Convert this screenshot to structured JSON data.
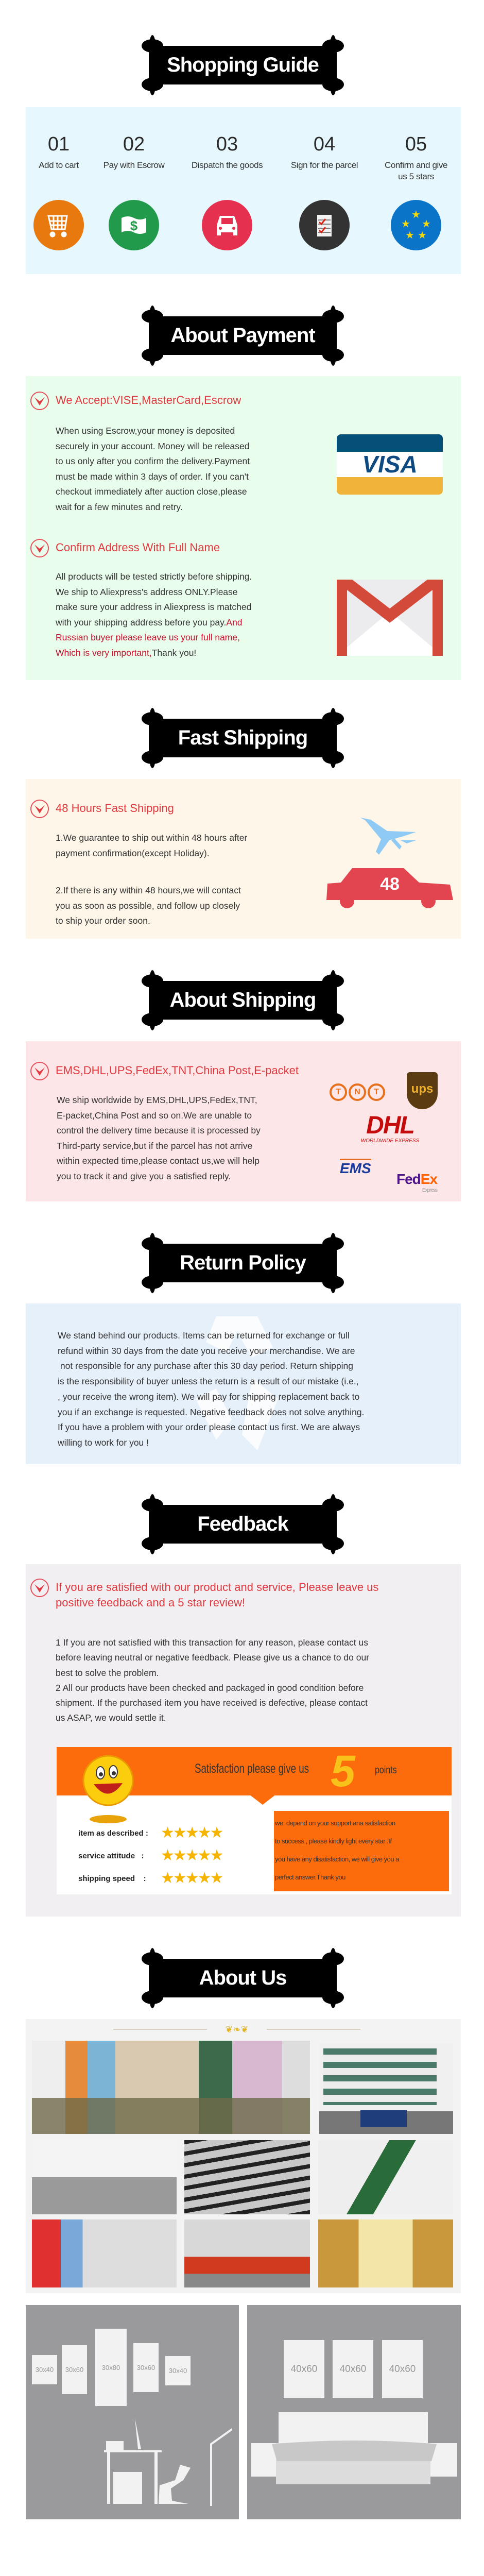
{
  "shopping_guide": {
    "title": "Shopping Guide",
    "steps": [
      {
        "num": "01",
        "label": "Add to cart",
        "icon": "cart-icon",
        "color": "#e8790f"
      },
      {
        "num": "02",
        "label": "Pay with Escrow",
        "icon": "money-icon",
        "color": "#229a4b"
      },
      {
        "num": "03",
        "label": "Dispatch the goods",
        "icon": "car-icon",
        "color": "#e5304f"
      },
      {
        "num": "04",
        "label": "Sign for the parcel",
        "icon": "checklist-icon",
        "color": "#333333"
      },
      {
        "num": "05",
        "label": "Confirm and give us 5 stars",
        "icon": "stars-icon",
        "color": "#0a74c9"
      }
    ]
  },
  "about_payment": {
    "title": "About Payment",
    "heading1": "We Accept:VISE,MasterCard,Escrow",
    "para1": [
      "When using Escrow,your money is deposited",
      "securely in your account. Money will be released",
      "to us only after you confirm the delivery.Payment",
      "must be made within 3 days of order. If you can't",
      "checkout immediately after auction close,please",
      "wait for a few minutes and retry."
    ],
    "visa_logo": "VISA",
    "heading2": "Confirm Address With Full Name",
    "para2": [
      "All products will be tested strictly before shipping.",
      "We ship to Aliexpress's address ONLY.Please",
      "make sure your address in Aliexpress is matched"
    ],
    "para2_line4": "with your shipping address before you pay.",
    "para2_line4_red": "And",
    "para2_red": [
      "Russian buyer please leave us your full name,"
    ],
    "para2_last_red": "Which is very important,",
    "para2_last": "Thank you!"
  },
  "fast_shipping": {
    "title": "Fast Shipping",
    "heading": "48 Hours Fast Shipping",
    "para1": [
      "1.We guarantee to ship out within 48 hours after",
      "payment confirmation(except Holiday)."
    ],
    "para2": [
      "2.If there is any within 48 hours,we will contact",
      "you as soon as possible, and follow up closely",
      "to ship your order soon."
    ],
    "car_badge": "48"
  },
  "about_shipping": {
    "title": "About Shipping",
    "heading": "EMS,DHL,UPS,FedEx,TNT,China Post,E-packet",
    "para": [
      "We ship worldwide by EMS,DHL,UPS,FedEx,TNT,",
      "E-packet,China Post and so on.We are unable to",
      "control the delivery time because it is processed by",
      "Third-party service,but if the parcel has not arrive",
      "within expected time,please contact us,we will help",
      "you to track it and give you a satisfied reply."
    ],
    "logos": {
      "tnt": "TNT",
      "ups": "ups",
      "dhl": "DHL",
      "dhl_sub": "WORLDWIDE EXPRESS",
      "ems": "EMS",
      "fedex_fed": "Fed",
      "fedex_ex": "Ex",
      "fedex_sub": "Express"
    }
  },
  "return_policy": {
    "title": "Return Policy",
    "para": [
      "We stand behind our products. Items can be returned for exchange or full",
      "refund within 30 days from the date you receive your merchandise. We are",
      " not responsible for any purchase after this 30 day period. Return shipping",
      "is the responsibility of buyer unless the return is a result of our mistake (i.e.,",
      ", your receive the wrong item). We will pay for shipping replacement back to",
      "you if an exchange is requested. Negative feedback does not solve anything.",
      "If you have a problem with your order please contact us first. We are always",
      "willing to work for you !"
    ]
  },
  "feedback": {
    "title": "Feedback",
    "heading": [
      "If you are satisfied with our product and service, Please leave us",
      "positive feedback and a 5 star review!"
    ],
    "para": [
      "1 If you are not satisfied with this transaction for any reason, please contact us",
      "before leaving neutral or negative feedback. Please give us a chance to do our",
      "best to solve the problem.",
      "2 All our products have been checked and packaged in good condition before",
      "shipment. If the purchased item you have received is defective, please contact",
      "us ASAP, we would settle it."
    ],
    "card": {
      "banner_text": "Satisfaction please give us",
      "big_number": "5",
      "points": "points",
      "ratings": [
        {
          "label": "item as described :",
          "stars": 5
        },
        {
          "label": "service attitude   :",
          "stars": 5
        },
        {
          "label": "shipping speed    :",
          "stars": 5
        }
      ],
      "message": [
        "we  depend on your support ana satisfaction",
        "to success , please kindly light every star .If",
        "you have any disatisfaction, we will give you a",
        "perfect answer.Thank you"
      ]
    }
  },
  "about_us": {
    "title": "About Us",
    "left_panel_sizes": [
      "30x40",
      "30x60",
      "30x80",
      "30x60",
      "30x40"
    ],
    "right_panel_sizes": [
      "40x60",
      "40x60",
      "40x60"
    ]
  }
}
